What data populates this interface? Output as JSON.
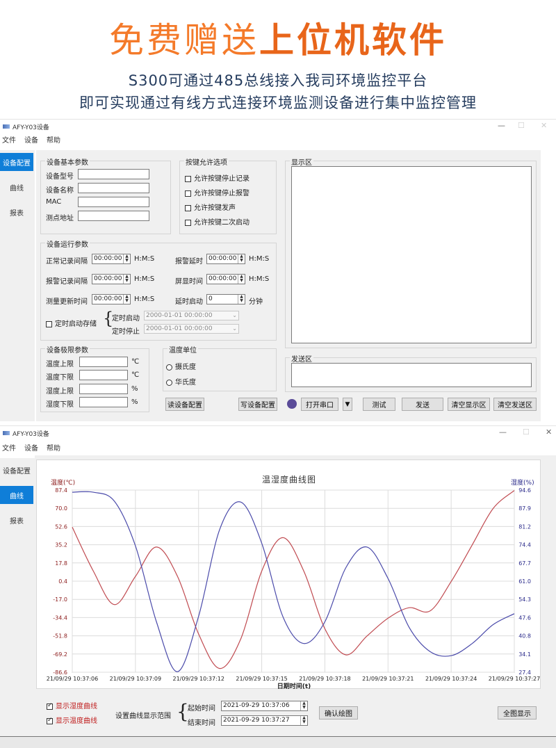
{
  "banner": {
    "headline_part1": "免费赠送",
    "headline_part2": "上位机软件",
    "subtitle1": "S300可通过485总线接入我司环境监控平台",
    "subtitle2": "即可实现通过有线方式连接环境监测设备进行集中监控管理"
  },
  "window1": {
    "title": "AFY-Y03设备",
    "menu": [
      "文件",
      "设备",
      "帮助"
    ],
    "sidebar": [
      "设备配置",
      "曲线",
      "报表"
    ],
    "basic": {
      "title": "设备基本参数",
      "model_label": "设备型号",
      "name_label": "设备名称",
      "mac_label": "MAC",
      "addr_label": "测点地址"
    },
    "keys": {
      "title": "按键允许选项",
      "options": [
        "允许按键停止记录",
        "允许按键停止报警",
        "允许按键发声",
        "允许按键二次启动"
      ]
    },
    "run": {
      "title": "设备运行参数",
      "normal_interval": "正常记录间隔",
      "alarm_interval": "报警记录间隔",
      "measure_interval": "测量更新时间",
      "alarm_delay": "报警延时",
      "screen_time": "屏显时间",
      "delay_start": "延时启动",
      "time_value": "00:00:00",
      "unit_hms": "H:M:S",
      "delay_value": "0",
      "unit_min": "分钟",
      "timed_store": "定时启动存储",
      "timed_start": "定时启动",
      "timed_stop": "定时停止",
      "dt_value": "2000-01-01 00:00:00"
    },
    "limits": {
      "title": "设备极限参数",
      "temp_upper": "温度上限",
      "temp_lower": "温度下限",
      "hum_upper": "湿度上限",
      "hum_lower": "湿度下限",
      "unit_c": "℃",
      "unit_pct": "%"
    },
    "temp_unit": {
      "title": "温度单位",
      "celsius": "摄氏度",
      "fahrenheit": "华氏度"
    },
    "display_area": "显示区",
    "send_area": "发送区",
    "buttons": {
      "read": "读设备配置",
      "write": "写设备配置",
      "open_port": "打开串口",
      "dropdown": "▼",
      "test": "测试",
      "send": "发送",
      "clear_display": "清空显示区",
      "clear_send": "清空发送区"
    }
  },
  "window2": {
    "title": "AFY-Y03设备",
    "menu": [
      "文件",
      "设备",
      "帮助"
    ],
    "sidebar": [
      "设备配置",
      "曲线",
      "报表"
    ],
    "controls": {
      "show_hum": "显示湿度曲线",
      "show_temp": "显示温度曲线",
      "range_label": "设置曲线显示范围",
      "start_label": "起始时间",
      "end_label": "结束时间",
      "start_value": "2021-09-29 10:37:06",
      "end_value": "2021-09-29 10:37:27",
      "confirm": "确认绘图",
      "full": "全图显示"
    }
  },
  "chart_data": {
    "type": "line",
    "title": "温湿度曲线图",
    "xlabel": "日期时间(t)",
    "ylabel_left": "温度(℃)",
    "ylabel_right": "湿度(%)",
    "x_ticks": [
      "21/09/29 10:37:06",
      "21/09/29 10:37:09",
      "21/09/29 10:37:12",
      "21/09/29 10:37:15",
      "21/09/29 10:37:18",
      "21/09/29 10:37:21",
      "21/09/29 10:37:24",
      "21/09/29 10:37:27"
    ],
    "y_left_ticks": [
      "87.4",
      "70.0",
      "52.6",
      "35.2",
      "17.8",
      "0.4",
      "-17.0",
      "-34.4",
      "-51.8",
      "-69.2",
      "-86.6"
    ],
    "y_right_ticks": [
      "94.6",
      "87.9",
      "81.2",
      "74.4",
      "67.7",
      "61.0",
      "54.3",
      "47.6",
      "40.8",
      "34.1",
      "27.4"
    ],
    "ylim_left": [
      -86.6,
      87.4
    ],
    "ylim_right": [
      27.4,
      94.6
    ],
    "xlim": [
      0,
      21
    ],
    "grid": true,
    "colors": {
      "temp": "#c04a50",
      "hum": "#4a4aaa",
      "left_axis": "#8b1a1a",
      "right_axis": "#2a2a8a"
    },
    "series": [
      {
        "axis": "left",
        "x": [
          0,
          1,
          2,
          3,
          4,
          5,
          6,
          7,
          8,
          9,
          10,
          11,
          12,
          13,
          14,
          15,
          16,
          17,
          18,
          19,
          20,
          21
        ],
        "values": [
          52,
          10,
          -22,
          5,
          33,
          5,
          -50,
          -83,
          -55,
          10,
          42,
          10,
          -45,
          -70,
          -52,
          -35,
          -25,
          -28,
          0,
          35,
          70,
          87
        ]
      },
      {
        "axis": "right",
        "x": [
          0,
          1,
          2,
          3,
          4,
          5,
          6,
          7,
          8,
          9,
          10,
          11,
          12,
          13,
          14,
          15,
          16,
          17,
          18,
          19,
          20,
          21
        ],
        "values": [
          93.8,
          93.8,
          90.5,
          74,
          46,
          27.6,
          48,
          80,
          90.2,
          75,
          48,
          38,
          46,
          66,
          73.6,
          62,
          44,
          35,
          33.5,
          38,
          45,
          49
        ]
      }
    ]
  }
}
